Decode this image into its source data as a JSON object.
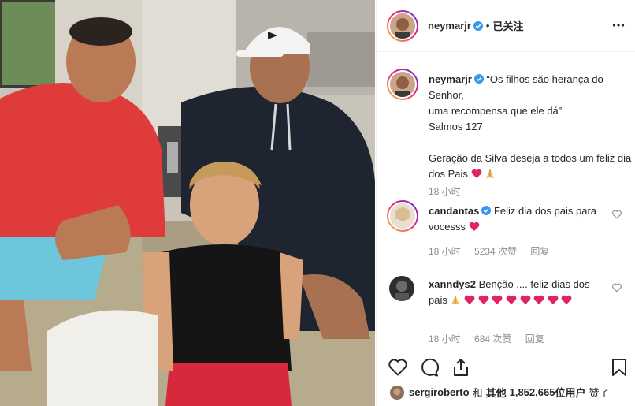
{
  "post": {
    "username": "neymarjr",
    "dot": "•",
    "follow_state": "已关注"
  },
  "caption": {
    "username": "neymarjr",
    "line1": "“Os filhos são herança do Senhor,",
    "line2": "uma recompensa que ele dá”",
    "line3": "Salmos 127",
    "line4": "Geração da Silva deseja a todos um feliz dia dos Pais",
    "time": "18 小时"
  },
  "comments": [
    {
      "username": "candantas",
      "text": "Feliz dia dos pais para vocesss",
      "time": "18 小时",
      "likes": "5234 次赞",
      "reply": "回复"
    },
    {
      "username": "xanndys2",
      "text": "Benção .... feliz dias dos pais",
      "time": "18 小时",
      "likes": "684 次赞",
      "reply": "回复"
    }
  ],
  "likes": {
    "user": "sergiroberto",
    "joiner": "和",
    "others_label": "其他",
    "count": "1,852,665",
    "suffix": "位用户",
    "liked": "赞了"
  },
  "colors": {
    "heart_red": "#e0245e",
    "verified_blue": "#3897f0",
    "meta_gray": "#8e8e8e"
  },
  "icons": [
    "more-icon",
    "verified-icon",
    "heart-icon",
    "comment-icon",
    "share-icon",
    "bookmark-icon",
    "heart-emoji",
    "pray-emoji"
  ]
}
